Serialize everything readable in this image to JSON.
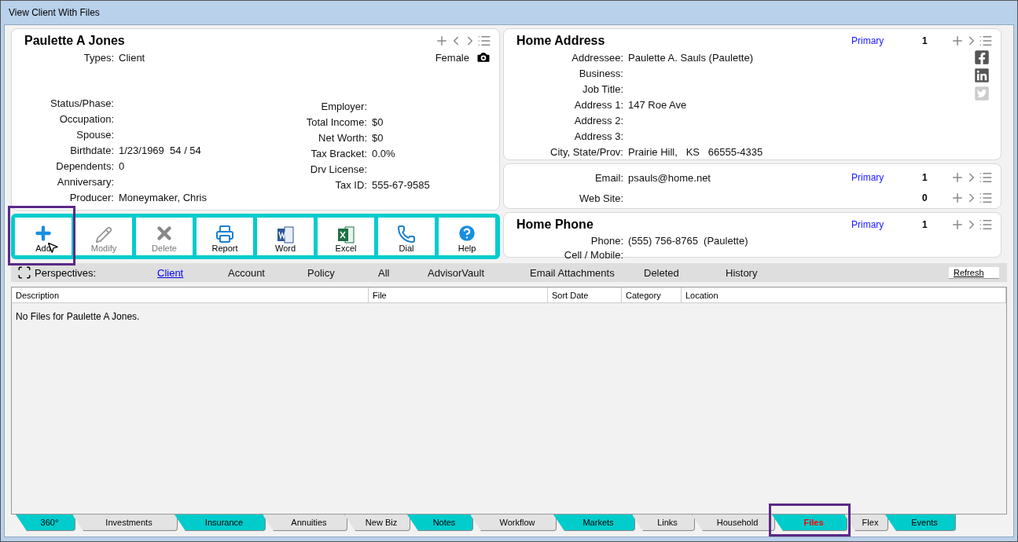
{
  "window": {
    "title": "View Client With Files"
  },
  "client": {
    "name": "Paulette A Jones",
    "gender": "Female",
    "types": {
      "label": "Types:",
      "value": "Client"
    },
    "left_fields": [
      {
        "label": "Status/Phase:"
      },
      {
        "label": "Occupation:"
      },
      {
        "label": "Spouse:"
      },
      {
        "label": "Birthdate:",
        "value": "1/23/1969  54 / 54"
      },
      {
        "label": "Dependents:",
        "value": "0"
      },
      {
        "label": "Anniversary:"
      },
      {
        "label": "Producer:",
        "value": "Moneymaker, Chris"
      }
    ],
    "right_fields": [
      {
        "label": "Employer:"
      },
      {
        "label": "Total Income:",
        "value": "$0"
      },
      {
        "label": "Net Worth:",
        "value": "$0"
      },
      {
        "label": "Tax Bracket:",
        "value": "0.0%"
      },
      {
        "label": "Drv License:"
      },
      {
        "label": "Tax ID:",
        "value": "555-67-9585"
      }
    ]
  },
  "toolbar": [
    {
      "label": "Add",
      "kind": "add",
      "disabled": false,
      "highlighted": true
    },
    {
      "label": "Modify",
      "kind": "modify",
      "disabled": true,
      "highlighted": false
    },
    {
      "label": "Delete",
      "kind": "delete",
      "disabled": true,
      "highlighted": false
    },
    {
      "label": "Report",
      "kind": "report",
      "disabled": false,
      "highlighted": false
    },
    {
      "label": "Word",
      "kind": "word",
      "disabled": false,
      "highlighted": false
    },
    {
      "label": "Excel",
      "kind": "excel",
      "disabled": false,
      "highlighted": false
    },
    {
      "label": "Dial",
      "kind": "dial",
      "disabled": false,
      "highlighted": false
    },
    {
      "label": "Help",
      "kind": "help",
      "disabled": false,
      "highlighted": false
    }
  ],
  "address": {
    "title": "Home Address",
    "primary": "Primary",
    "count": "1",
    "fields": [
      {
        "label": "Addressee:",
        "value": "Paulette A. Sauls (Paulette)"
      },
      {
        "label": "Business:"
      },
      {
        "label": "Job Title:"
      },
      {
        "label": "Address 1:",
        "value": "147 Roe Ave"
      },
      {
        "label": "Address 2:"
      },
      {
        "label": "Address 3:"
      },
      {
        "label": "City, State/Prov:",
        "value": "Prairie Hill,   KS   66555-4335"
      }
    ]
  },
  "contact": [
    {
      "label": "Email:",
      "value": "psauls@home.net",
      "primary": "Primary",
      "count": "1"
    },
    {
      "label": "Web Site:",
      "count": "0"
    }
  ],
  "phone": {
    "title": "Home Phone",
    "primary": "Primary",
    "count": "1",
    "fields": [
      {
        "label": "Phone:",
        "value": "(555) 756-8765  (Paulette)"
      },
      {
        "label": "Cell / Mobile:"
      }
    ]
  },
  "perspectives": {
    "label": "Perspectives:",
    "refresh": "Refresh",
    "items": [
      {
        "label": "Client",
        "selected": true
      },
      {
        "label": "Account",
        "selected": false
      },
      {
        "label": "Policy",
        "selected": false
      },
      {
        "label": "All",
        "selected": false
      },
      {
        "label": "AdvisorVault",
        "selected": false
      },
      {
        "label": "Email Attachments",
        "selected": false
      },
      {
        "label": "Deleted",
        "selected": false
      },
      {
        "label": "History",
        "selected": false
      }
    ]
  },
  "table": {
    "columns": [
      "Description",
      "File",
      "Sort Date",
      "Category",
      "Location"
    ],
    "empty_message": "No Files for Paulette A Jones."
  },
  "tabs": [
    {
      "label": "360°",
      "color": "#00cccc",
      "selected": false,
      "highlighted": false
    },
    {
      "label": "Investments",
      "color": "#e3e3e3",
      "selected": false,
      "highlighted": false
    },
    {
      "label": "Insurance",
      "color": "#00cccc",
      "selected": false,
      "highlighted": false
    },
    {
      "label": "Annuities",
      "color": "#e3e3e3",
      "selected": false,
      "highlighted": false
    },
    {
      "label": "New Biz",
      "color": "#e3e3e3",
      "selected": false,
      "highlighted": false
    },
    {
      "label": "Notes",
      "color": "#00cccc",
      "selected": false,
      "highlighted": false
    },
    {
      "label": "Workflow",
      "color": "#e3e3e3",
      "selected": false,
      "highlighted": false
    },
    {
      "label": "Markets",
      "color": "#00cccc",
      "selected": false,
      "highlighted": false
    },
    {
      "label": "Links",
      "color": "#e3e3e3",
      "selected": false,
      "highlighted": false
    },
    {
      "label": "Household",
      "color": "#e3e3e3",
      "selected": false,
      "highlighted": false
    },
    {
      "label": "Files",
      "color": "#00cccc",
      "selected": true,
      "highlighted": true
    },
    {
      "label": "Flex",
      "color": "#e3e3e3",
      "selected": false,
      "highlighted": false
    },
    {
      "label": "Events",
      "color": "#00cccc",
      "selected": false,
      "highlighted": false
    }
  ]
}
